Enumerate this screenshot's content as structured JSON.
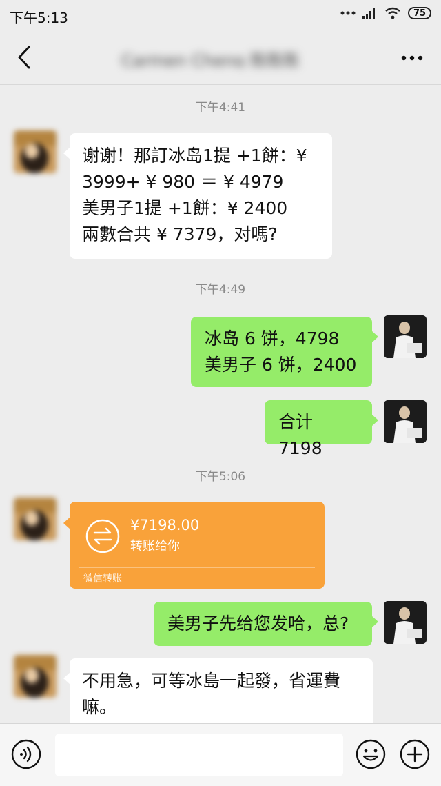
{
  "status_bar": {
    "time": "下午5:13",
    "battery": "75"
  },
  "header": {
    "contact_name": "Carmen Cheng 陈陈陈"
  },
  "messages": [
    {
      "timestamp": "下午4:41"
    },
    {
      "from": "contact",
      "lines": [
        "谢谢！那訂冰岛1提 +1餅：¥",
        "3999+ ¥ 980 ＝ ¥ 4979",
        "美男子1提 +1餅：¥ 2400",
        "兩數合共 ¥ 7379，对嗎?"
      ]
    },
    {
      "timestamp": "下午4:49"
    },
    {
      "from": "me",
      "lines": [
        "冰岛 6 饼，4798",
        "美男子 6 饼，2400"
      ]
    },
    {
      "from": "me",
      "lines": [
        "合计 7198"
      ]
    },
    {
      "timestamp": "下午5:06"
    },
    {
      "from": "contact",
      "transfer": {
        "amount": "¥7198.00",
        "note": "转账给你",
        "brand": "微信转账"
      }
    },
    {
      "from": "me",
      "lines": [
        "美男子先给您发哈，总?"
      ]
    },
    {
      "from": "contact",
      "lines": [
        "不用急，可等冰島一起發，省運費",
        "嘛。"
      ]
    }
  ],
  "input_bar": {
    "placeholder": ""
  },
  "colors": {
    "sent_bubble": "#95ec69",
    "received_bubble": "#ffffff",
    "transfer_card": "#f9a23a",
    "background": "#ededed"
  },
  "icons": [
    "back-chevron-icon",
    "more-dots-icon",
    "voice-icon",
    "emoji-icon",
    "plus-icon",
    "transfer-arrows-icon"
  ]
}
